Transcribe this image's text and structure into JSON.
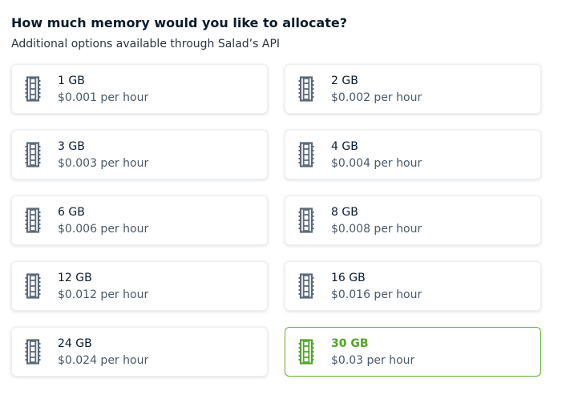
{
  "header": {
    "title": "How much memory would you like to allocate?",
    "subtitle": "Additional options available through Salad’s API"
  },
  "theme": {
    "selected_color": "#53a52a",
    "icon_color": "#5c6a78"
  },
  "options": [
    {
      "size": "1 GB",
      "price": "$0.001 per hour",
      "icon": "memory-stick-icon",
      "selected": false
    },
    {
      "size": "2 GB",
      "price": "$0.002 per hour",
      "icon": "memory-stick-icon",
      "selected": false
    },
    {
      "size": "3 GB",
      "price": "$0.003 per hour",
      "icon": "memory-stick-icon",
      "selected": false
    },
    {
      "size": "4 GB",
      "price": "$0.004 per hour",
      "icon": "memory-stick-icon",
      "selected": false
    },
    {
      "size": "6 GB",
      "price": "$0.006 per hour",
      "icon": "memory-stick-icon",
      "selected": false
    },
    {
      "size": "8 GB",
      "price": "$0.008 per hour",
      "icon": "memory-stick-icon",
      "selected": false
    },
    {
      "size": "12 GB",
      "price": "$0.012 per hour",
      "icon": "memory-stick-icon",
      "selected": false
    },
    {
      "size": "16 GB",
      "price": "$0.016 per hour",
      "icon": "memory-stick-icon",
      "selected": false
    },
    {
      "size": "24 GB",
      "price": "$0.024 per hour",
      "icon": "memory-stick-icon",
      "selected": false
    },
    {
      "size": "30 GB",
      "price": "$0.03 per hour",
      "icon": "memory-stick-icon",
      "selected": true
    }
  ]
}
